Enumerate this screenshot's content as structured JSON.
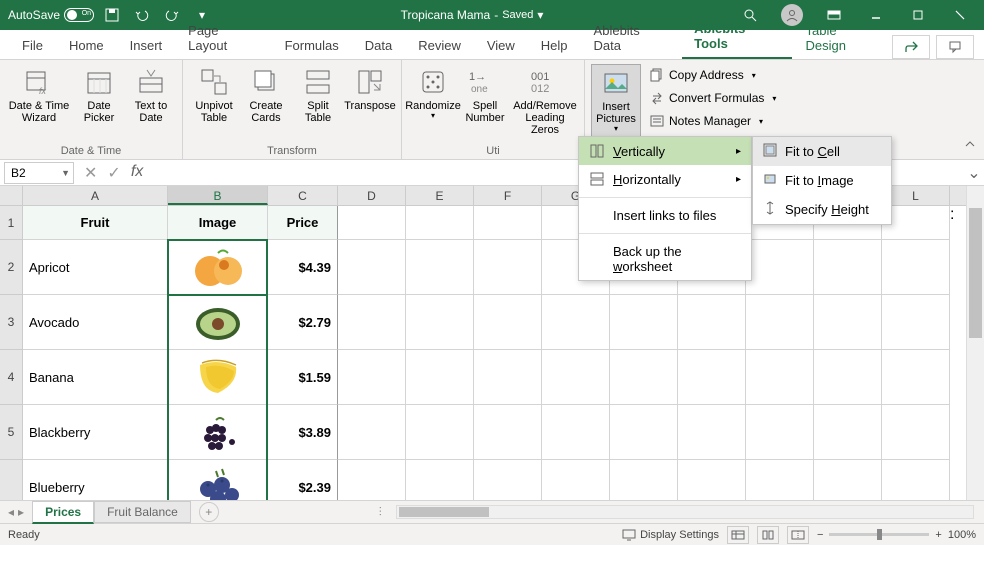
{
  "titlebar": {
    "autosave_label": "AutoSave",
    "toggle_on": "On",
    "doc_title": "Tropicana Mama",
    "saved_status": "Saved"
  },
  "tabs": {
    "file": "File",
    "home": "Home",
    "insert": "Insert",
    "page_layout": "Page Layout",
    "formulas": "Formulas",
    "data": "Data",
    "review": "Review",
    "view": "View",
    "help": "Help",
    "ablebits_data": "Ablebits Data",
    "ablebits_tools": "Ablebits Tools",
    "table_design": "Table Design"
  },
  "ribbon": {
    "date_time_wizard": "Date & Time Wizard",
    "date_picker": "Date Picker",
    "text_to_date": "Text to Date",
    "group_datetime": "Date & Time",
    "unpivot_table": "Unpivot Table",
    "create_cards": "Create Cards",
    "split_table": "Split Table",
    "transpose": "Transpose",
    "group_transform": "Transform",
    "randomize": "Randomize",
    "spell_number": "Spell Number",
    "add_remove_zeros": "Add/Remove Leading Zeros",
    "insert_pictures": "Insert Pictures",
    "copy_address": "Copy Address",
    "convert_formulas": "Convert Formulas",
    "notes_manager": "Notes Manager",
    "group_uti": "Uti"
  },
  "menu1": {
    "vertically": "Vertically",
    "horizontally": "Horizontally",
    "insert_links": "Insert links to files",
    "backup": "Back up the worksheet"
  },
  "menu2": {
    "fit_cell": "Fit to Cell",
    "fit_image": "Fit to Image",
    "specify_height": "Specify Height"
  },
  "formula_bar": {
    "name_box": "B2",
    "formula": ""
  },
  "grid": {
    "cols": [
      "A",
      "B",
      "C",
      "D",
      "E",
      "F",
      "G",
      "H",
      "I",
      "J",
      "K",
      "L"
    ],
    "rows": [
      "1",
      "2",
      "3",
      "4",
      "5"
    ],
    "headers": {
      "fruit": "Fruit",
      "image": "Image",
      "price": "Price"
    },
    "data": [
      {
        "fruit": "Apricot",
        "price": "$4.39"
      },
      {
        "fruit": "Avocado",
        "price": "$2.79"
      },
      {
        "fruit": "Banana",
        "price": "$1.59"
      },
      {
        "fruit": "Blackberry",
        "price": "$3.89"
      },
      {
        "fruit": "Blueberry",
        "price": "$2.39"
      }
    ]
  },
  "sheets": {
    "prices": "Prices",
    "fruit_balance": "Fruit Balance"
  },
  "statusbar": {
    "ready": "Ready",
    "display_settings": "Display Settings",
    "zoom": "100%"
  },
  "chart_data": null
}
